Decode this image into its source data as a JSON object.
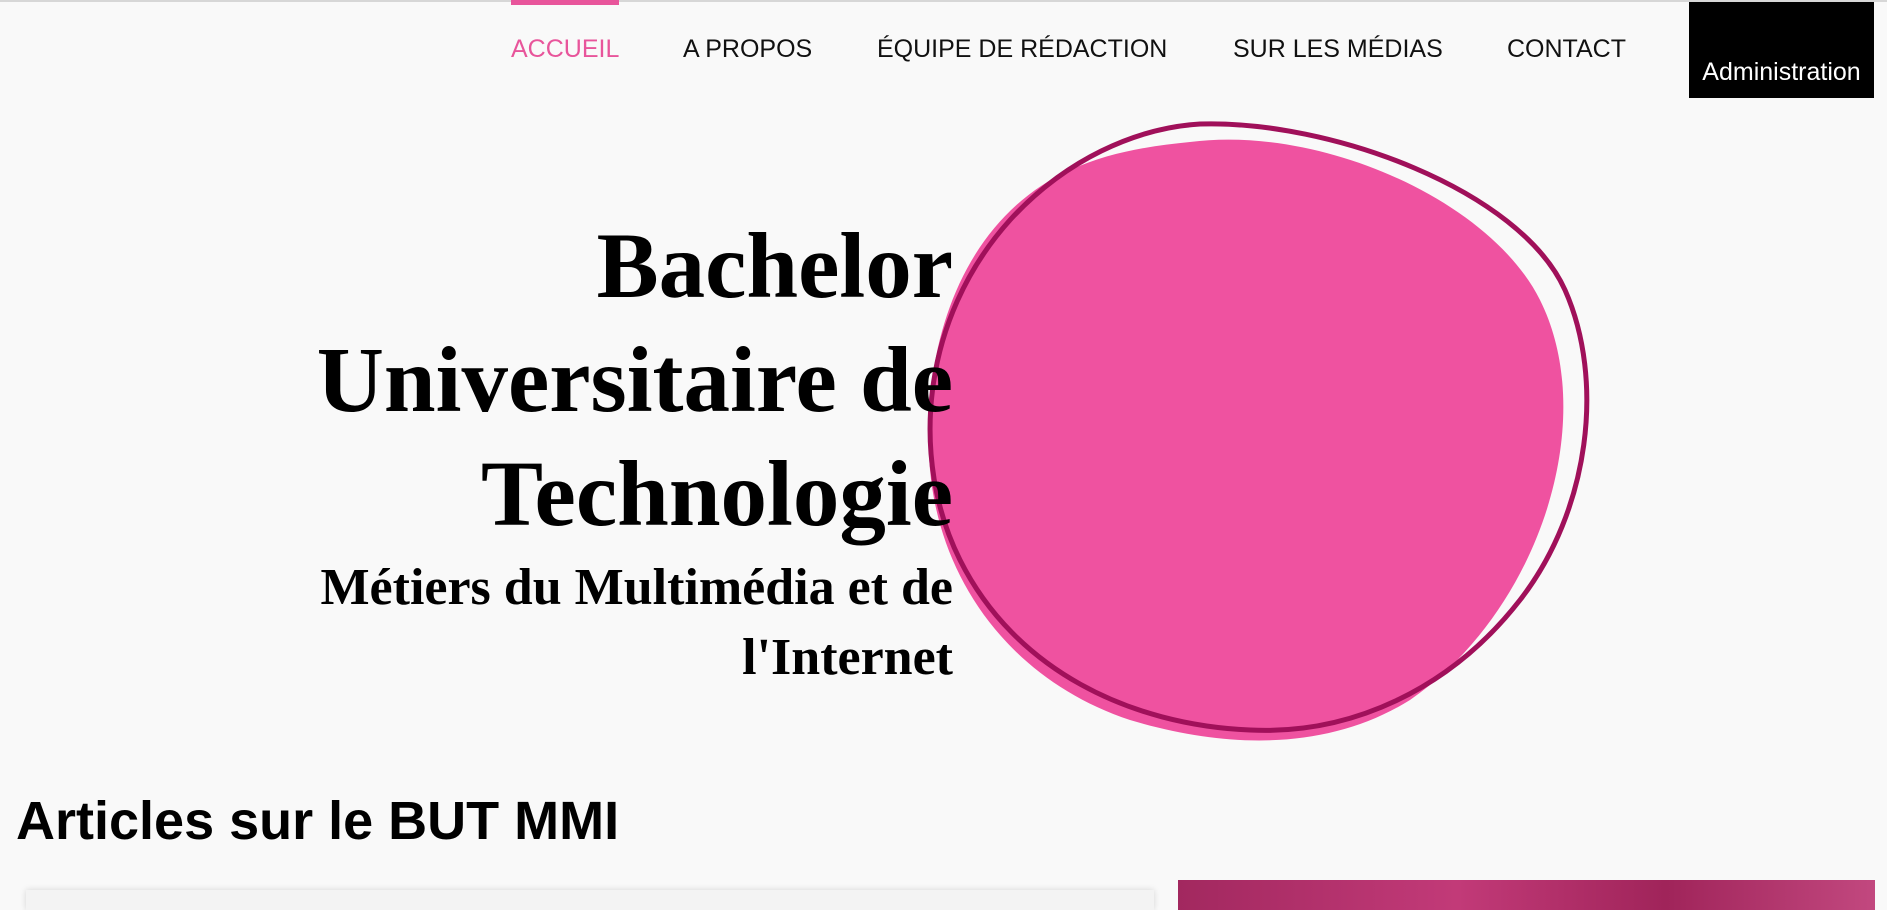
{
  "nav": {
    "items": [
      {
        "label": "ACCUEIL",
        "active": true
      },
      {
        "label": "A PROPOS",
        "active": false
      },
      {
        "label": "ÉQUIPE DE RÉDACTION",
        "active": false
      },
      {
        "label": "SUR LES MÉDIAS",
        "active": false
      },
      {
        "label": "CONTACT",
        "active": false
      }
    ],
    "admin_label": "Administration"
  },
  "hero": {
    "title_lines": [
      "Bachelor",
      "Universitaire de",
      "Technologie"
    ],
    "subtitle_lines": [
      "Métiers du Multimédia et de",
      "l'Internet"
    ]
  },
  "articles": {
    "heading": "Articles sur le BUT MMI"
  },
  "colors": {
    "accent": "#e8559b",
    "blob_fill": "#ef52a0",
    "blob_outline": "#a0105a",
    "admin_bg": "#000000",
    "background": "#f9f9f9"
  }
}
